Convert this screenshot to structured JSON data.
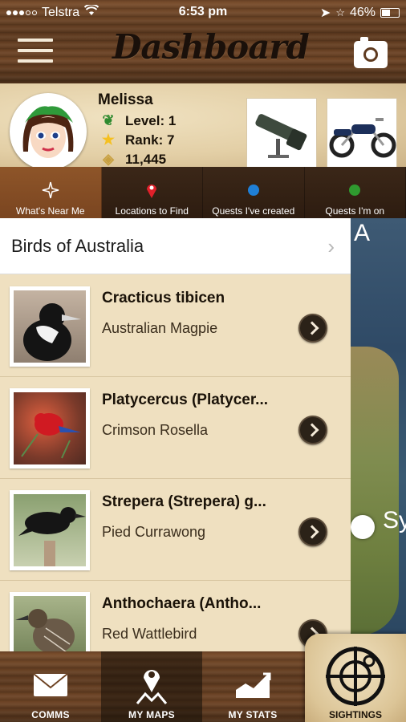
{
  "status_bar": {
    "carrier": "Telstra",
    "time": "6:53 pm",
    "battery": "46%"
  },
  "header": {
    "title": "Dashboard",
    "menu_icon": "hamburger-menu-icon",
    "camera_icon": "camera-icon"
  },
  "profile": {
    "name": "Melissa",
    "level": "Level: 1",
    "rank": "Rank: 7",
    "points": "11,445",
    "promo_items": [
      "spotting-scope",
      "motorcycle"
    ]
  },
  "tabs": [
    {
      "label": "What's Near Me",
      "icon": "compass-icon",
      "active": true
    },
    {
      "label": "Locations to Find",
      "icon": "map-pin-icon",
      "color": "#e0202a"
    },
    {
      "label": "Quests I've created",
      "icon": "blue-dot",
      "color": "#1f7fd6"
    },
    {
      "label": "Quests I'm on",
      "icon": "green-dot",
      "color": "#2f9a2f"
    }
  ],
  "list": {
    "title": "Birds of Australia",
    "items": [
      {
        "scientific": "Cracticus tibicen",
        "common": "Australian Magpie"
      },
      {
        "scientific": "Platycercus (Platycer...",
        "common": "Crimson Rosella"
      },
      {
        "scientific": "Strepera (Strepera) g...",
        "common": "Pied Currawong"
      },
      {
        "scientific": "Anthochaera (Antho...",
        "common": "Red Wattlebird"
      }
    ]
  },
  "map": {
    "labels": [
      "A",
      "Sy"
    ]
  },
  "bottom_nav": [
    {
      "label": "COMMS",
      "icon": "envelope-icon"
    },
    {
      "label": "MY MAPS",
      "icon": "map-location-icon",
      "active": true
    },
    {
      "label": "MY STATS",
      "icon": "chart-icon"
    },
    {
      "label": "SIGHTINGS",
      "icon": "target-icon"
    }
  ],
  "colors": {
    "active_tab": "#8e5529",
    "list_bg": "#efe0c0",
    "wood": "#5e3a1f"
  }
}
